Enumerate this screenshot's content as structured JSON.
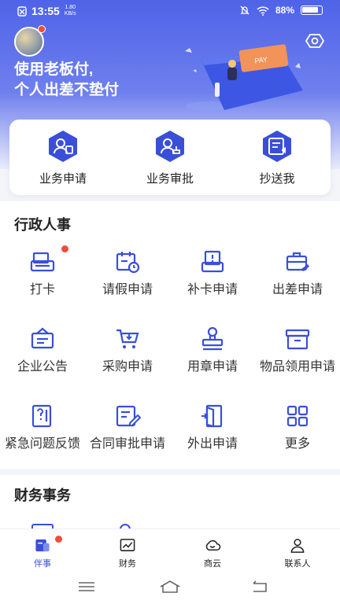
{
  "status_bar": {
    "time": "13:55",
    "net_speed_value": "1.80",
    "net_speed_unit": "KB/s",
    "battery": "88%"
  },
  "header": {
    "slogan_line1": "使用老板付,",
    "slogan_line2": "个人出差不垫付",
    "illustration_text": "PAY"
  },
  "quick_actions": [
    {
      "label": "业务申请",
      "icon": "user-card-icon"
    },
    {
      "label": "业务审批",
      "icon": "user-approve-icon"
    },
    {
      "label": "抄送我",
      "icon": "cc-message-icon"
    }
  ],
  "admin_section": {
    "title": "行政人事",
    "items": [
      {
        "label": "打卡",
        "icon": "punch-in-icon"
      },
      {
        "label": "请假申请",
        "icon": "leave-calendar-icon"
      },
      {
        "label": "补卡申请",
        "icon": "card-supplement-icon"
      },
      {
        "label": "出差申请",
        "icon": "business-trip-icon"
      },
      {
        "label": "企业公告",
        "icon": "announcement-icon"
      },
      {
        "label": "采购申请",
        "icon": "purchase-cart-icon"
      },
      {
        "label": "用章申请",
        "icon": "seal-stamp-icon"
      },
      {
        "label": "物品领用申请",
        "icon": "goods-box-icon"
      },
      {
        "label": "紧急问题反馈",
        "icon": "urgent-feedback-icon"
      },
      {
        "label": "合同审批申请",
        "icon": "contract-edit-icon"
      },
      {
        "label": "外出申请",
        "icon": "door-exit-icon"
      },
      {
        "label": "更多",
        "icon": "more-grid-icon"
      }
    ]
  },
  "finance_section": {
    "title": "财务事务"
  },
  "tab_bar": [
    {
      "label": "伴事",
      "icon": "companion-icon",
      "active": true
    },
    {
      "label": "财务",
      "icon": "finance-chart-icon",
      "active": false
    },
    {
      "label": "商云",
      "icon": "cloud-icon",
      "active": false
    },
    {
      "label": "联系人",
      "icon": "contacts-icon",
      "active": false
    }
  ],
  "colors": {
    "primary": "#3a4fd8",
    "accent_red": "#f04d3a",
    "header_top": "#4f63e8"
  }
}
